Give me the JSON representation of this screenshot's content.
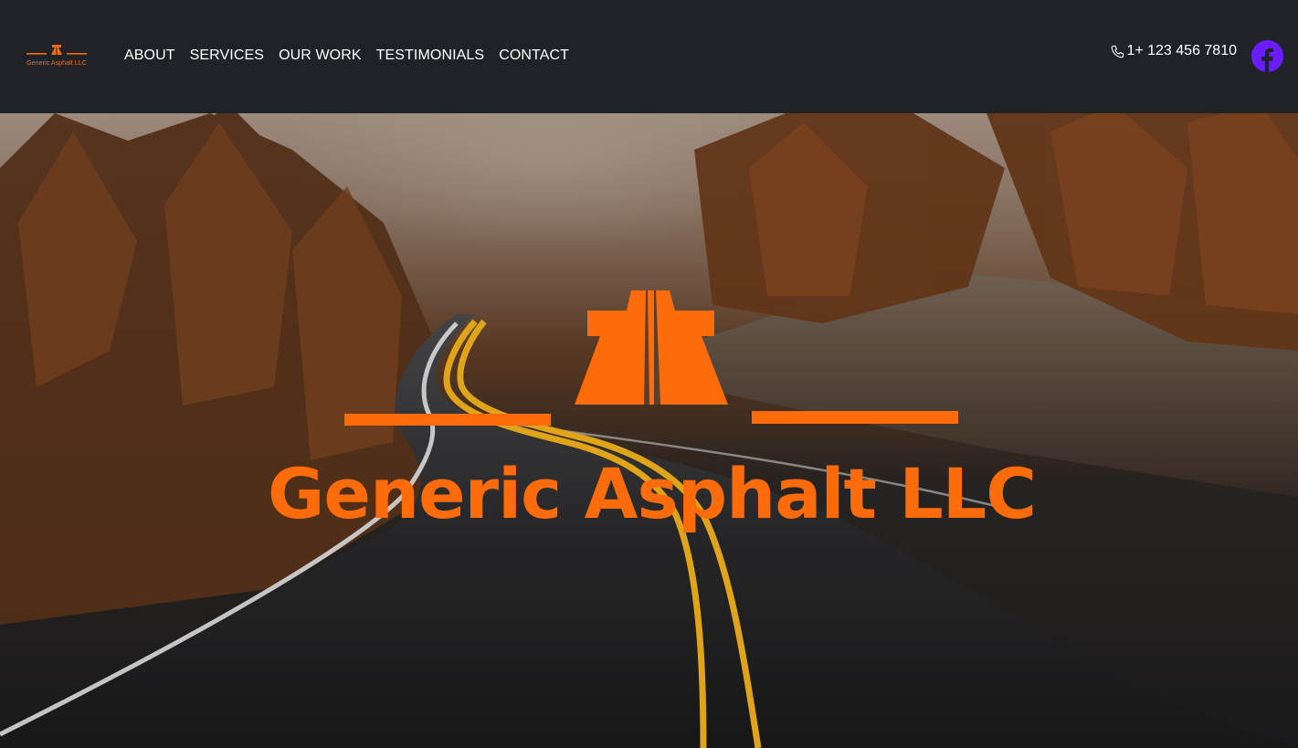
{
  "brand": {
    "name": "Generic Asphalt LLC",
    "logo_text": "Generic Asphalt LLC",
    "accent_color": "#fd6b0b"
  },
  "nav": {
    "items": [
      {
        "label": "ABOUT"
      },
      {
        "label": "SERVICES"
      },
      {
        "label": "OUR WORK"
      },
      {
        "label": "TESTIMONIALS"
      },
      {
        "label": "CONTACT"
      }
    ]
  },
  "contact": {
    "phone": "1+ 123 456 7810",
    "phone_icon": "phone-icon",
    "social_icon": "facebook-icon",
    "social_color": "#6a1cff"
  },
  "hero": {
    "title": "Generic Asphalt LLC",
    "emblem_icon": "highway-icon",
    "background": "forest-road-photo"
  }
}
